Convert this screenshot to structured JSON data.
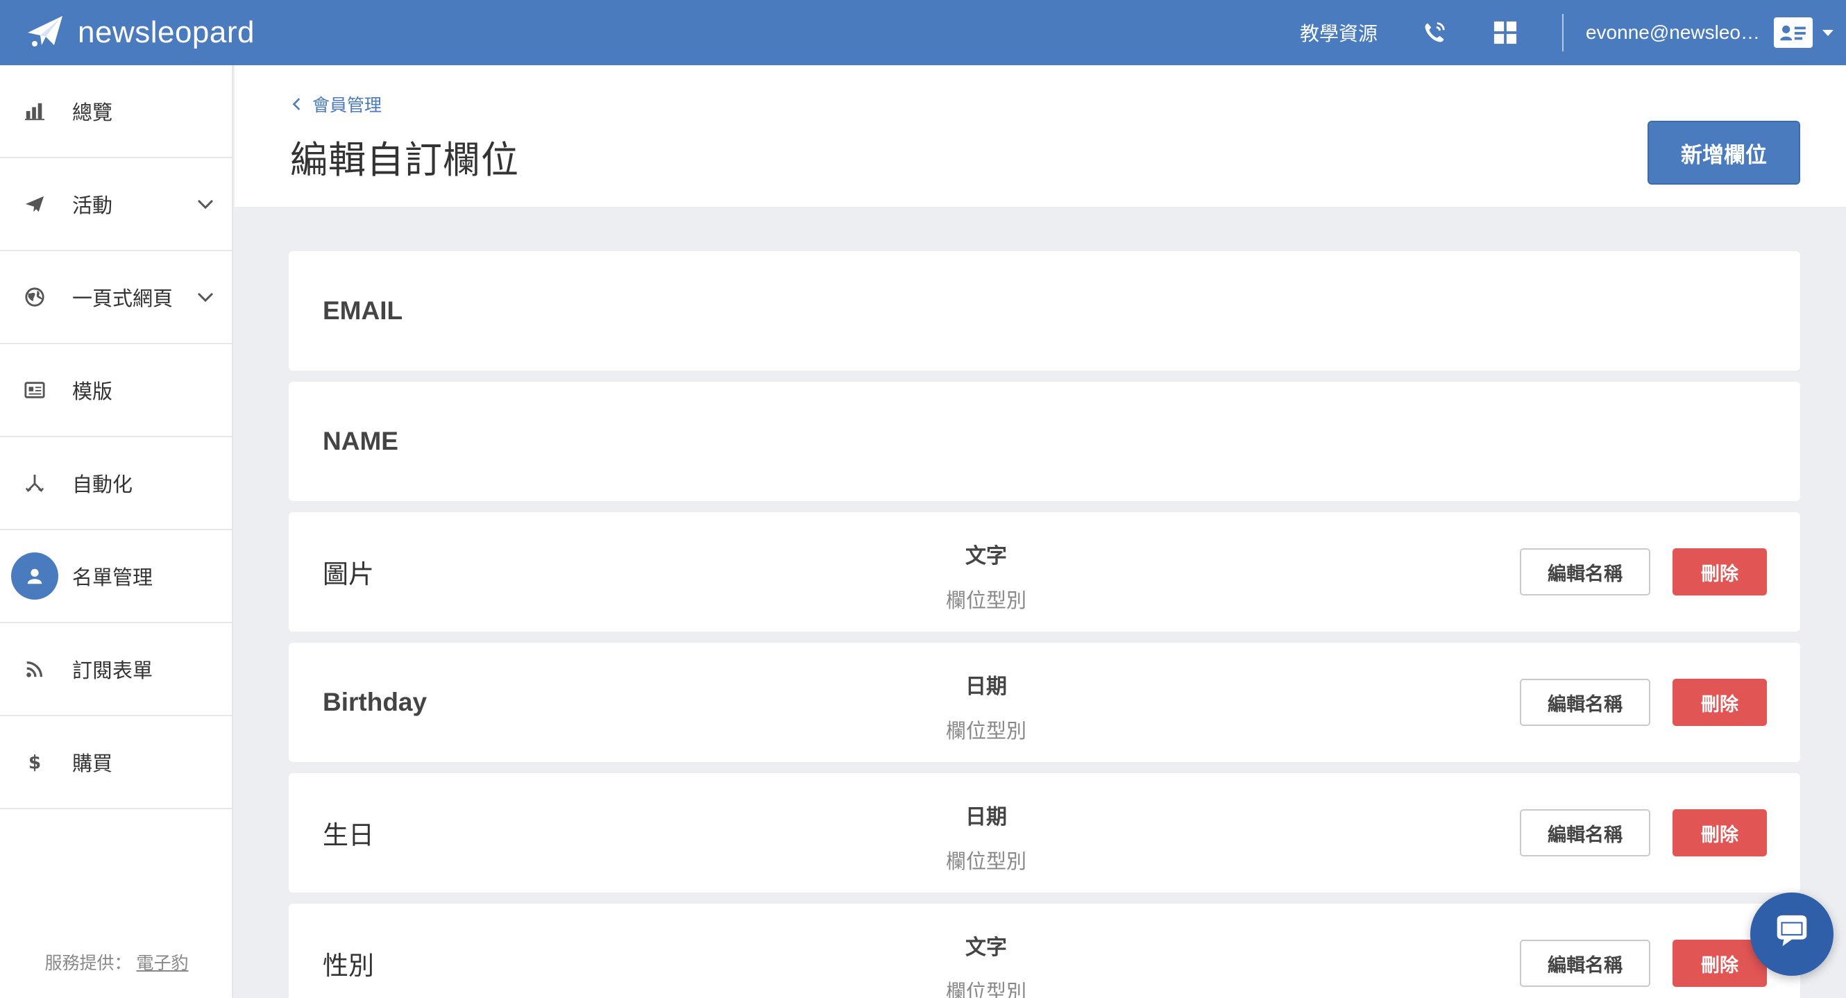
{
  "brand": {
    "name": "newsleopard"
  },
  "topbar": {
    "tutorial_link": "教學資源",
    "user_email": "evonne@newsleo…",
    "icons": [
      "phone-icon",
      "apps-grid-icon",
      "contact-card-icon"
    ]
  },
  "sidebar": {
    "items": [
      {
        "label": "總覽",
        "icon": "bar-chart-icon",
        "has_submenu": false
      },
      {
        "label": "活動",
        "icon": "paper-plane-icon",
        "has_submenu": true
      },
      {
        "label": "一頁式網頁",
        "icon": "globe-icon",
        "has_submenu": true
      },
      {
        "label": "模版",
        "icon": "template-icon",
        "has_submenu": false
      },
      {
        "label": "自動化",
        "icon": "automation-icon",
        "has_submenu": false
      },
      {
        "label": "名單管理",
        "icon": "user-icon",
        "has_submenu": false,
        "active": true
      },
      {
        "label": "訂閱表單",
        "icon": "rss-icon",
        "has_submenu": false
      },
      {
        "label": "購買",
        "icon": "dollar-icon",
        "has_submenu": false
      }
    ],
    "footer": {
      "prefix": "服務提供：",
      "link": "電子豹"
    }
  },
  "header": {
    "breadcrumb": "會員管理",
    "title": "編輯自訂欄位",
    "add_button": "新增欄位"
  },
  "fields": [
    {
      "name": "EMAIL",
      "fixed": true
    },
    {
      "name": "NAME",
      "fixed": true
    },
    {
      "name": "圖片",
      "type": "文字",
      "type_caption": "欄位型別",
      "edit_label": "編輯名稱",
      "delete_label": "刪除"
    },
    {
      "name": "Birthday",
      "type": "日期",
      "type_caption": "欄位型別",
      "edit_label": "編輯名稱",
      "delete_label": "刪除"
    },
    {
      "name": "生日",
      "type": "日期",
      "type_caption": "欄位型別",
      "edit_label": "編輯名稱",
      "delete_label": "刪除"
    },
    {
      "name": "性別",
      "type": "文字",
      "type_caption": "欄位型別",
      "edit_label": "編輯名稱",
      "delete_label": "刪除"
    }
  ],
  "colors": {
    "topbar": "#4a7bbe",
    "primary": "#4a7bbe",
    "danger": "#e15555",
    "page_bg": "#eceef2"
  }
}
